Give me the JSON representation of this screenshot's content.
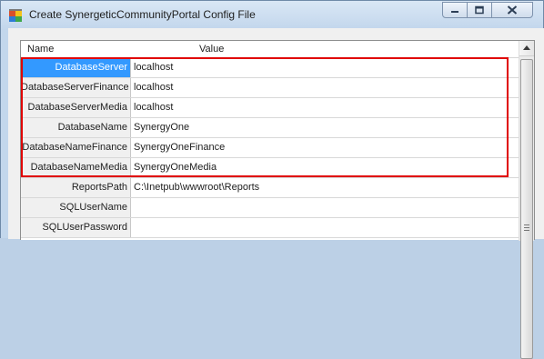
{
  "window": {
    "title": "Create SynergeticCommunityPortal Config File",
    "icon": "app-config-icon",
    "controls": [
      "minimize-icon",
      "maximize-icon",
      "close-icon"
    ]
  },
  "grid": {
    "header": {
      "name": "Name",
      "value": "Value"
    },
    "rows": [
      {
        "name": "DatabaseServer",
        "value": "localhost",
        "selected": true
      },
      {
        "name": "DatabaseServerFinance",
        "value": "localhost"
      },
      {
        "name": "DatabaseServerMedia",
        "value": "localhost"
      },
      {
        "name": "DatabaseName",
        "value": "SynergyOne"
      },
      {
        "name": "DatabaseNameFinance",
        "value": "SynergyOneFinance"
      },
      {
        "name": "DatabaseNameMedia",
        "value": "SynergyOneMedia"
      },
      {
        "name": "ReportsPath",
        "value": "C:\\Inetpub\\wwwroot\\Reports"
      },
      {
        "name": "SQLUserName",
        "value": ""
      },
      {
        "name": "SQLUserPassword",
        "value": ""
      }
    ]
  },
  "colors": {
    "selection": "#3399ff",
    "highlight_box": "#e00000",
    "titlebar": "#c3d7ec"
  }
}
